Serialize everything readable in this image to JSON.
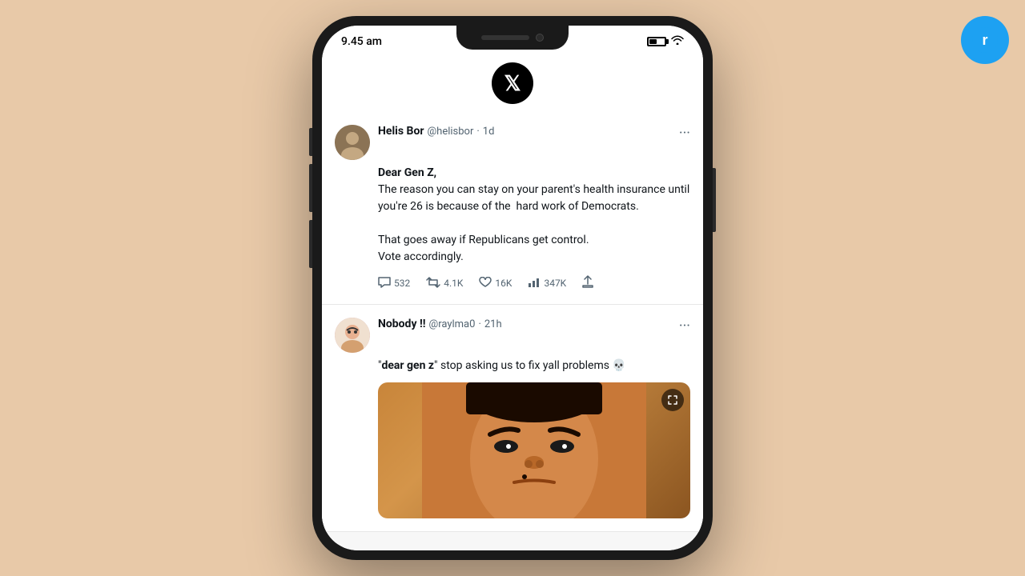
{
  "app": {
    "background_color": "#e8c9a8",
    "brand_logo_letter": "r"
  },
  "phone": {
    "status_bar": {
      "time": "9.45 am",
      "battery_level": "50%",
      "wifi": true
    },
    "x_logo": "X"
  },
  "feed": {
    "tweets": [
      {
        "id": "tweet-1",
        "author_name": "Helis Bor",
        "author_handle": "@helisbor",
        "time": "1d",
        "body_bold": "Dear Gen Z,",
        "body_text": "The reason you can stay on your parent's health insurance until you're 26 is because of the  hard work of Democrats.\n\nThat goes away if Republicans get control.\nVote accordingly.",
        "stats": {
          "replies": "532",
          "retweets": "4.1K",
          "likes": "16K",
          "views": "347K"
        }
      },
      {
        "id": "tweet-2",
        "author_name": "Nobody !!",
        "author_handle": "@raylma0",
        "time": "21h",
        "body_text": "\"dear gen z\" stop asking us to fix yall problems 💀",
        "has_image": true
      }
    ]
  },
  "actions": {
    "reply_icon": "💬",
    "retweet_icon": "🔁",
    "like_icon": "♡",
    "views_icon": "📊",
    "share_icon": "⬆",
    "more_icon": "···"
  }
}
